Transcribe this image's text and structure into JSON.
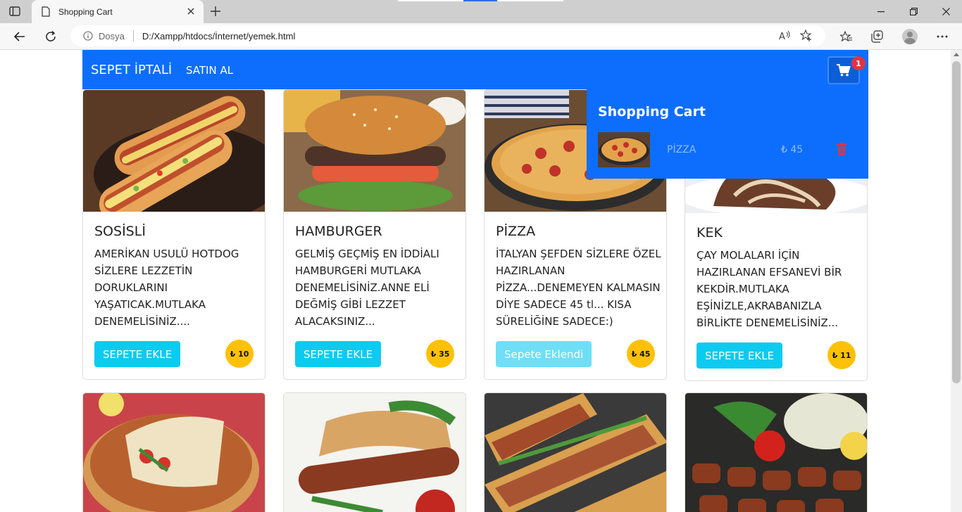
{
  "browser": {
    "tab_title": "Shopping Cart",
    "scheme_label": "Dosya",
    "url": "D:/Xampp/htdocs/İnternet/yemek.html"
  },
  "navbar": {
    "cancel_label": "SEPET İPTALİ",
    "buy_label": "SATIN AL",
    "cart_count": "1",
    "colors": {
      "navbar": "#0d6efd",
      "badge": "#dc3545"
    }
  },
  "cart": {
    "title": "Shopping Cart",
    "items": [
      {
        "name": "PİZZA",
        "price": "₺ 45"
      }
    ]
  },
  "products": [
    {
      "title": "SOSİSLİ",
      "desc": "AMERİKAN USULÜ HOTDOG SİZLERE LEZZETİN DORUKLARINI YAŞATICAK.MUTLAKA DENEMELİSİNİZ....",
      "button": "SEPETE EKLE",
      "price": "₺ 10"
    },
    {
      "title": "HAMBURGER",
      "desc": "GELMİŞ GEÇMİŞ EN İDDİALI HAMBURGERİ MUTLAKA DENEMELİSİNİZ.ANNE ELİ DEĞMİŞ GİBİ LEZZET ALACAKSINIZ...",
      "button": "SEPETE EKLE",
      "price": "₺ 35"
    },
    {
      "title": "PİZZA",
      "desc": "İTALYAN ŞEFDEN SİZLERE ÖZEL HAZIRLANAN PİZZA...DENEMEYEN KALMASIN DİYE SADECE 45 tl... KISA SÜRELİĞİNE SADECE:)",
      "button": "Sepete Eklendi",
      "price": "₺ 45"
    },
    {
      "title": "KEK",
      "desc": "ÇAY MOLALARI İÇİN HAZIRLANAN EFSANEVİ BİR KEKDİR.MUTLAKA EŞİNİZLE,AKRABANIZLA BİRLİKTE DENEMELİSİNİZ...",
      "button": "SEPETE EKLE",
      "price": "₺ 11"
    }
  ],
  "colors": {
    "button": "#0dcaf0",
    "button_added": "#6edff6",
    "price_badge": "#ffc107"
  }
}
